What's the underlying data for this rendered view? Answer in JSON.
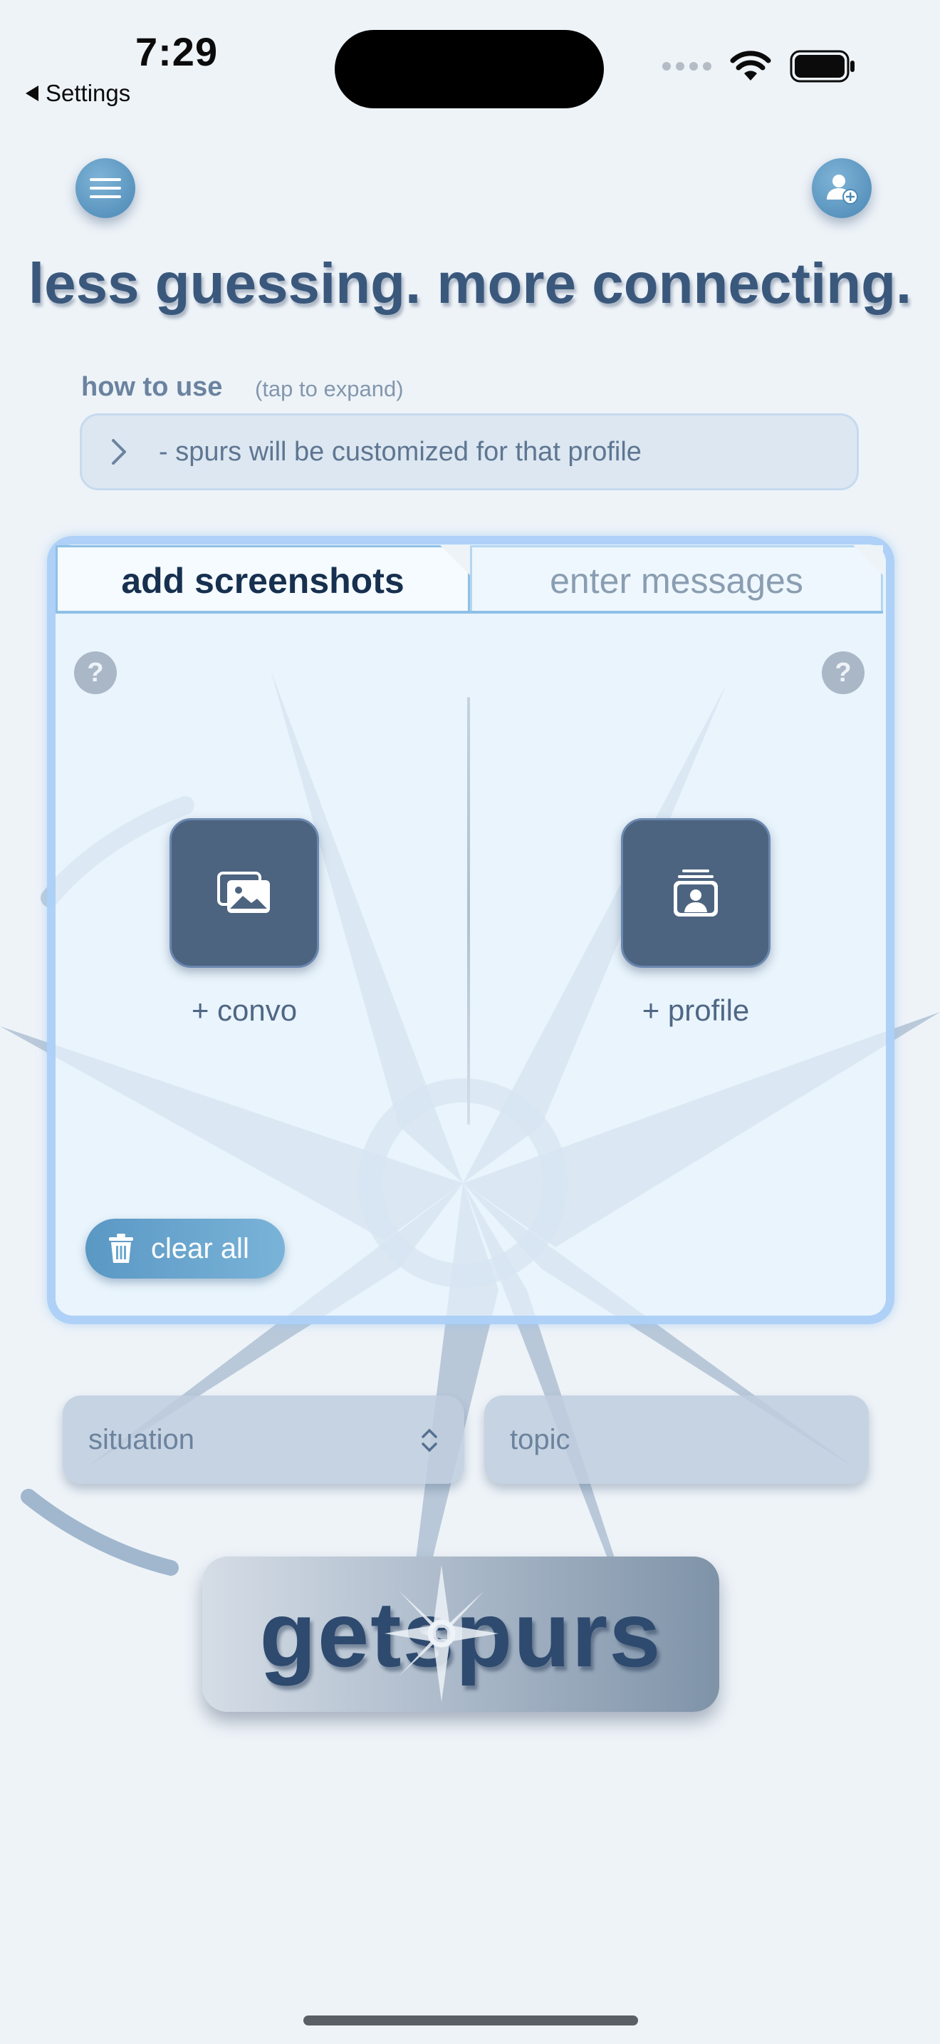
{
  "status_bar": {
    "time": "7:29",
    "back_label": "Settings"
  },
  "header": {
    "tagline": "less guessing. more connecting."
  },
  "how_to_use": {
    "label": "how to use",
    "hint": "(tap to expand)",
    "text": "- spurs will be customized for that profile"
  },
  "tabs": [
    {
      "label": "add screenshots",
      "active": true
    },
    {
      "label": "enter messages",
      "active": false
    }
  ],
  "upload": {
    "convo_label": "+ convo",
    "profile_label": "+ profile",
    "help_glyph": "?"
  },
  "clear_all_label": "clear all",
  "situation": {
    "placeholder": "situation"
  },
  "topic": {
    "placeholder": "topic"
  },
  "cta_label": "getspurs",
  "colors": {
    "accent": "#5a98c4",
    "dark_button": "#4d6480",
    "title": "#3a587c",
    "panel_border": "#a8cdf6"
  },
  "icons": [
    "menu-icon",
    "add-user-icon",
    "chevron-right-icon",
    "help-icon",
    "photos-icon",
    "profile-card-icon",
    "trash-icon",
    "up-down-chevron-icon",
    "compass-star-icon"
  ]
}
